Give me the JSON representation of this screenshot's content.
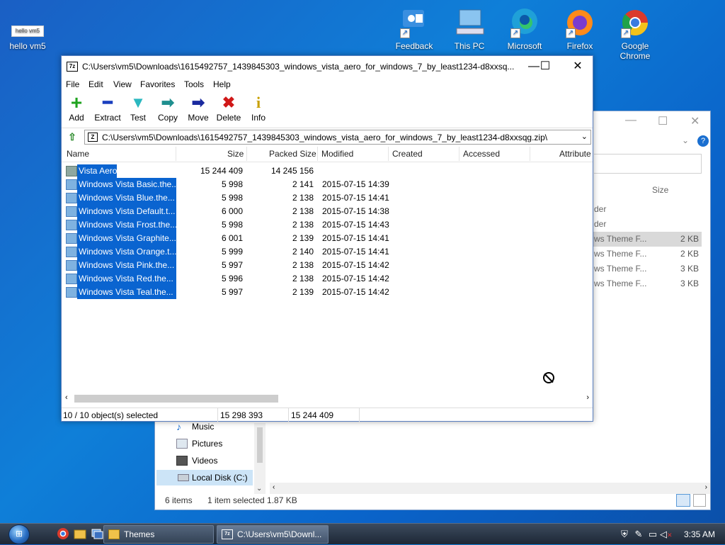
{
  "desktop": {
    "icons": [
      {
        "label": "hello vm5",
        "thumb_text": "hello vm5"
      },
      {
        "label": "Feedback Hub"
      },
      {
        "label": "This PC"
      },
      {
        "label": "Microsoft Edge"
      },
      {
        "label": "Firefox"
      },
      {
        "label": "Google Chrome"
      }
    ]
  },
  "explorer": {
    "column_size": "Size",
    "rows": [
      {
        "type": "der",
        "size": ""
      },
      {
        "type": "der",
        "size": ""
      },
      {
        "type": "ws Theme F...",
        "size": "2 KB"
      },
      {
        "type": "ws Theme F...",
        "size": "2 KB"
      },
      {
        "type": "ws Theme F...",
        "size": "3 KB"
      },
      {
        "type": "ws Theme F...",
        "size": "3 KB"
      }
    ],
    "nav": [
      "Music",
      "Pictures",
      "Videos",
      "Local Disk (C:)"
    ],
    "status_items": "6 items",
    "status_selected": "1 item selected  1.87 KB"
  },
  "sevenzip": {
    "title": "C:\\Users\\vm5\\Downloads\\1615492757_1439845303_windows_vista_aero_for_windows_7_by_least1234-d8xxsq...",
    "menu": [
      "File",
      "Edit",
      "View",
      "Favorites",
      "Tools",
      "Help"
    ],
    "toolbar": [
      {
        "label": "Add",
        "glyph": "+",
        "color": "#1fa31f"
      },
      {
        "label": "Extract",
        "glyph": "━",
        "color": "#1a3fbf"
      },
      {
        "label": "Test",
        "glyph": "▼",
        "color": "#2bb8c0"
      },
      {
        "label": "Copy",
        "glyph": "➡",
        "color": "#1f8f8f"
      },
      {
        "label": "Move",
        "glyph": "➡",
        "color": "#1a2a9f"
      },
      {
        "label": "Delete",
        "glyph": "✖",
        "color": "#d01818"
      },
      {
        "label": "Info",
        "glyph": "i",
        "color": "#c8a000"
      }
    ],
    "address": "C:\\Users\\vm5\\Downloads\\1615492757_1439845303_windows_vista_aero_for_windows_7_by_least1234-d8xxsqg.zip\\",
    "columns": [
      "Name",
      "Size",
      "Packed Size",
      "Modified",
      "Created",
      "Accessed",
      "Attribute"
    ],
    "files": [
      {
        "name": "Vista Aero",
        "size": "15 244 409",
        "packed": "14 245 156",
        "modified": "",
        "folder": true
      },
      {
        "name": "Windows Vista Basic.the...",
        "size": "5 998",
        "packed": "2 141",
        "modified": "2015-07-15 14:39"
      },
      {
        "name": "Windows Vista Blue.the...",
        "size": "5 998",
        "packed": "2 138",
        "modified": "2015-07-15 14:41"
      },
      {
        "name": "Windows Vista Default.t...",
        "size": "6 000",
        "packed": "2 138",
        "modified": "2015-07-15 14:38"
      },
      {
        "name": "Windows Vista Frost.the...",
        "size": "5 998",
        "packed": "2 138",
        "modified": "2015-07-15 14:43"
      },
      {
        "name": "Windows Vista Graphite...",
        "size": "6 001",
        "packed": "2 139",
        "modified": "2015-07-15 14:41"
      },
      {
        "name": "Windows Vista Orange.t...",
        "size": "5 999",
        "packed": "2 140",
        "modified": "2015-07-15 14:41"
      },
      {
        "name": "Windows Vista Pink.the...",
        "size": "5 997",
        "packed": "2 138",
        "modified": "2015-07-15 14:42"
      },
      {
        "name": "Windows Vista Red.the...",
        "size": "5 996",
        "packed": "2 138",
        "modified": "2015-07-15 14:42"
      },
      {
        "name": "Windows Vista Teal.the...",
        "size": "5 997",
        "packed": "2 139",
        "modified": "2015-07-15 14:42"
      }
    ],
    "status": {
      "selected": "10 / 10 object(s) selected",
      "size": "15 298 393",
      "packed": "15 244 409"
    }
  },
  "taskbar": {
    "tasks": [
      "Themes",
      "C:\\Users\\vm5\\Downl..."
    ],
    "clock": "3:35 AM"
  }
}
